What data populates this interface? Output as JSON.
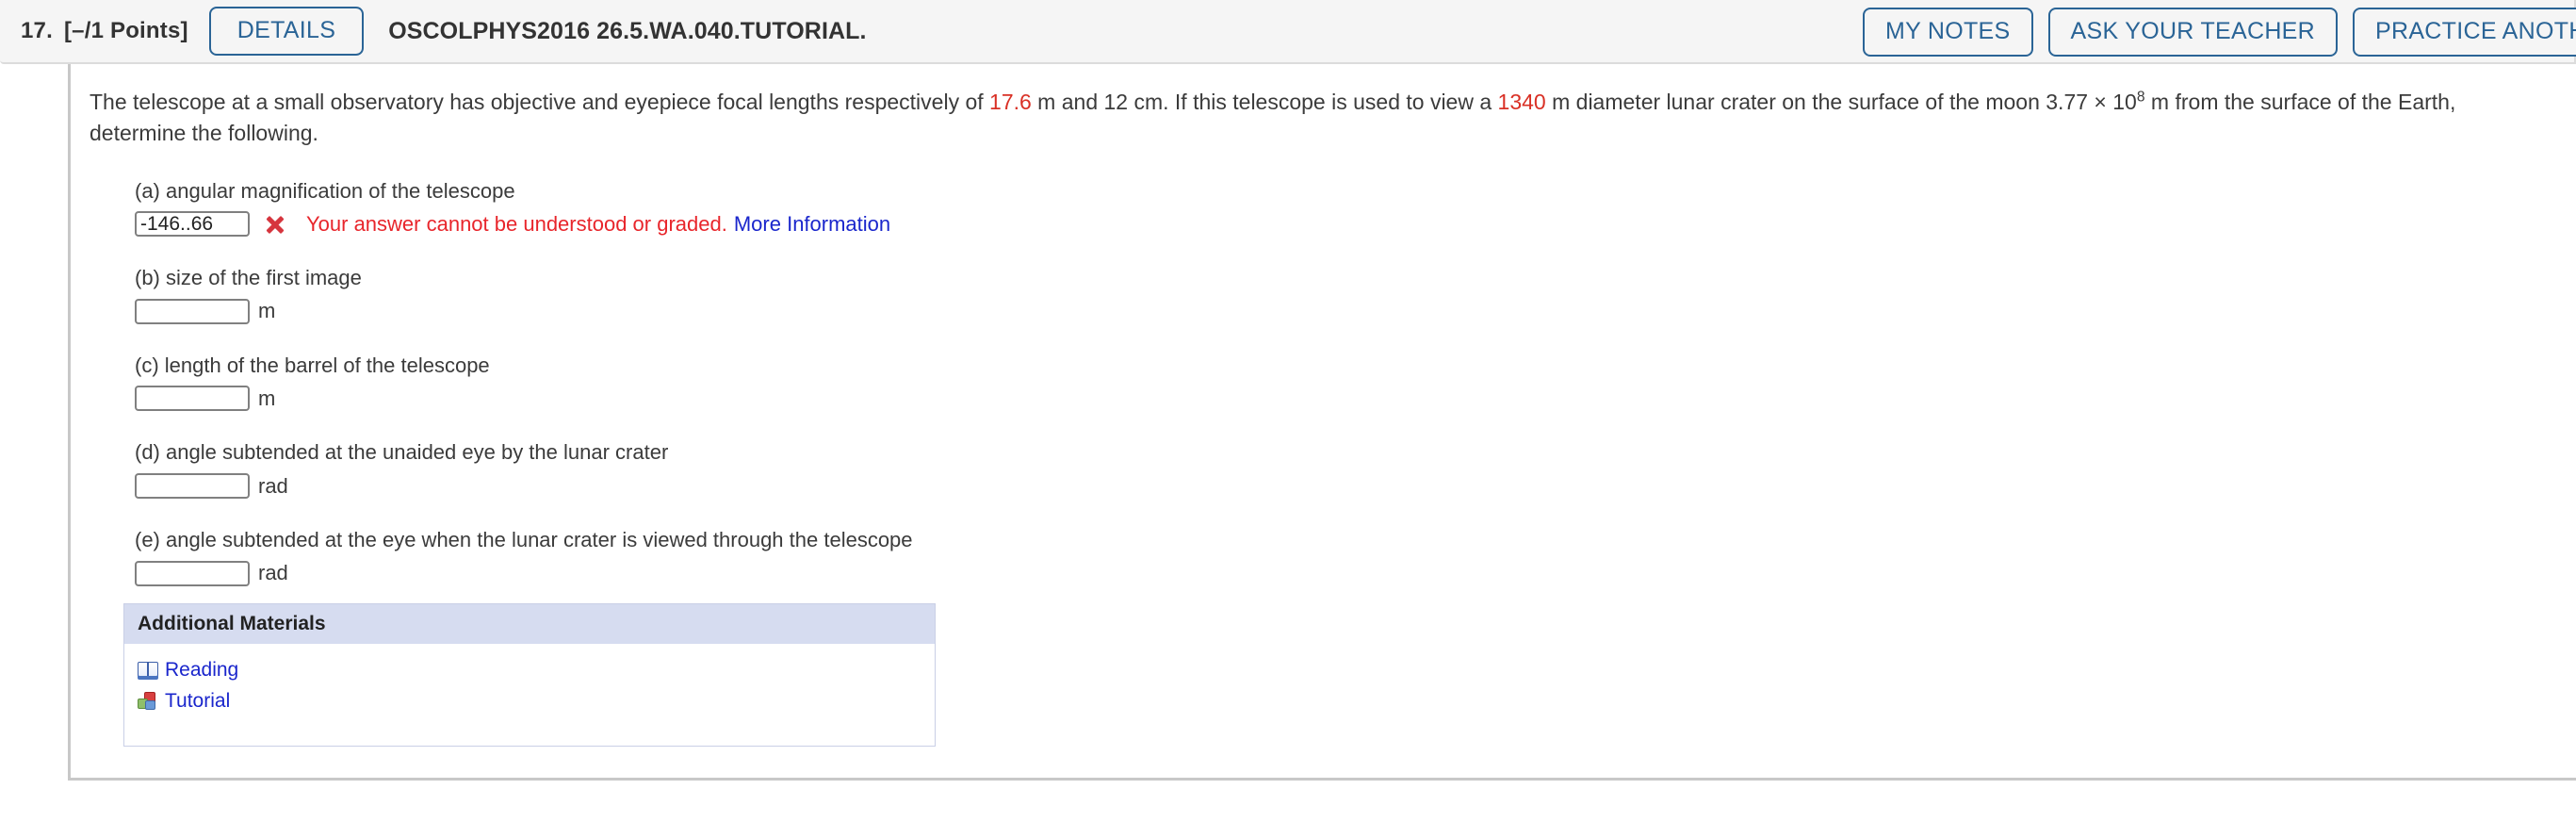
{
  "header": {
    "question_number": "17.",
    "points": "[–/1 Points]",
    "details_button": "DETAILS",
    "assignment_code": "OSCOLPHYS2016 26.5.WA.040.TUTORIAL.",
    "buttons": [
      {
        "label": "MY NOTES",
        "name": "my-notes-button"
      },
      {
        "label": "ASK YOUR TEACHER",
        "name": "ask-your-teacher-button"
      },
      {
        "label": "PRACTICE ANOTHER",
        "name": "practice-another-button"
      }
    ]
  },
  "problem": {
    "stem_part1": "The telescope at a small observatory has objective and eyepiece focal lengths respectively of ",
    "focal_objective": "17.6",
    "stem_part2": " m and 12 cm. If this telescope is used to view a ",
    "crater_diameter": "1340",
    "stem_part3": " m diameter lunar crater on the surface of the moon 3.77 ",
    "times_symbol": "×",
    "mantissa_base": " 10",
    "exponent": "8",
    "stem_part4": " m from the surface of the Earth, determine the following."
  },
  "parts": [
    {
      "label": "(a) angular magnification of the telescope",
      "value": "-146..66",
      "unit": "",
      "has_error": true,
      "error_text": "Your answer cannot be understood or graded.",
      "error_link": "More Information"
    },
    {
      "label": "(b) size of the first image",
      "value": "",
      "unit": "m",
      "has_error": false
    },
    {
      "label": "(c) length of the barrel of the telescope",
      "value": "",
      "unit": "m",
      "has_error": false
    },
    {
      "label": "(d) angle subtended at the unaided eye by the lunar crater",
      "value": "",
      "unit": "rad",
      "has_error": false
    },
    {
      "label": "(e) angle subtended at the eye when the lunar crater is viewed through the telescope",
      "value": "",
      "unit": "rad",
      "has_error": false
    }
  ],
  "additional_materials": {
    "title": "Additional Materials",
    "items": [
      {
        "label": "Reading",
        "icon": "book-icon"
      },
      {
        "label": "Tutorial",
        "icon": "cubes-icon"
      }
    ]
  },
  "colors": {
    "accent_blue": "#2a6496",
    "error_red": "#e8252b",
    "link_blue": "#1a26cc",
    "highlight_red": "#d93025",
    "panel_header": "#d6dcf0"
  }
}
